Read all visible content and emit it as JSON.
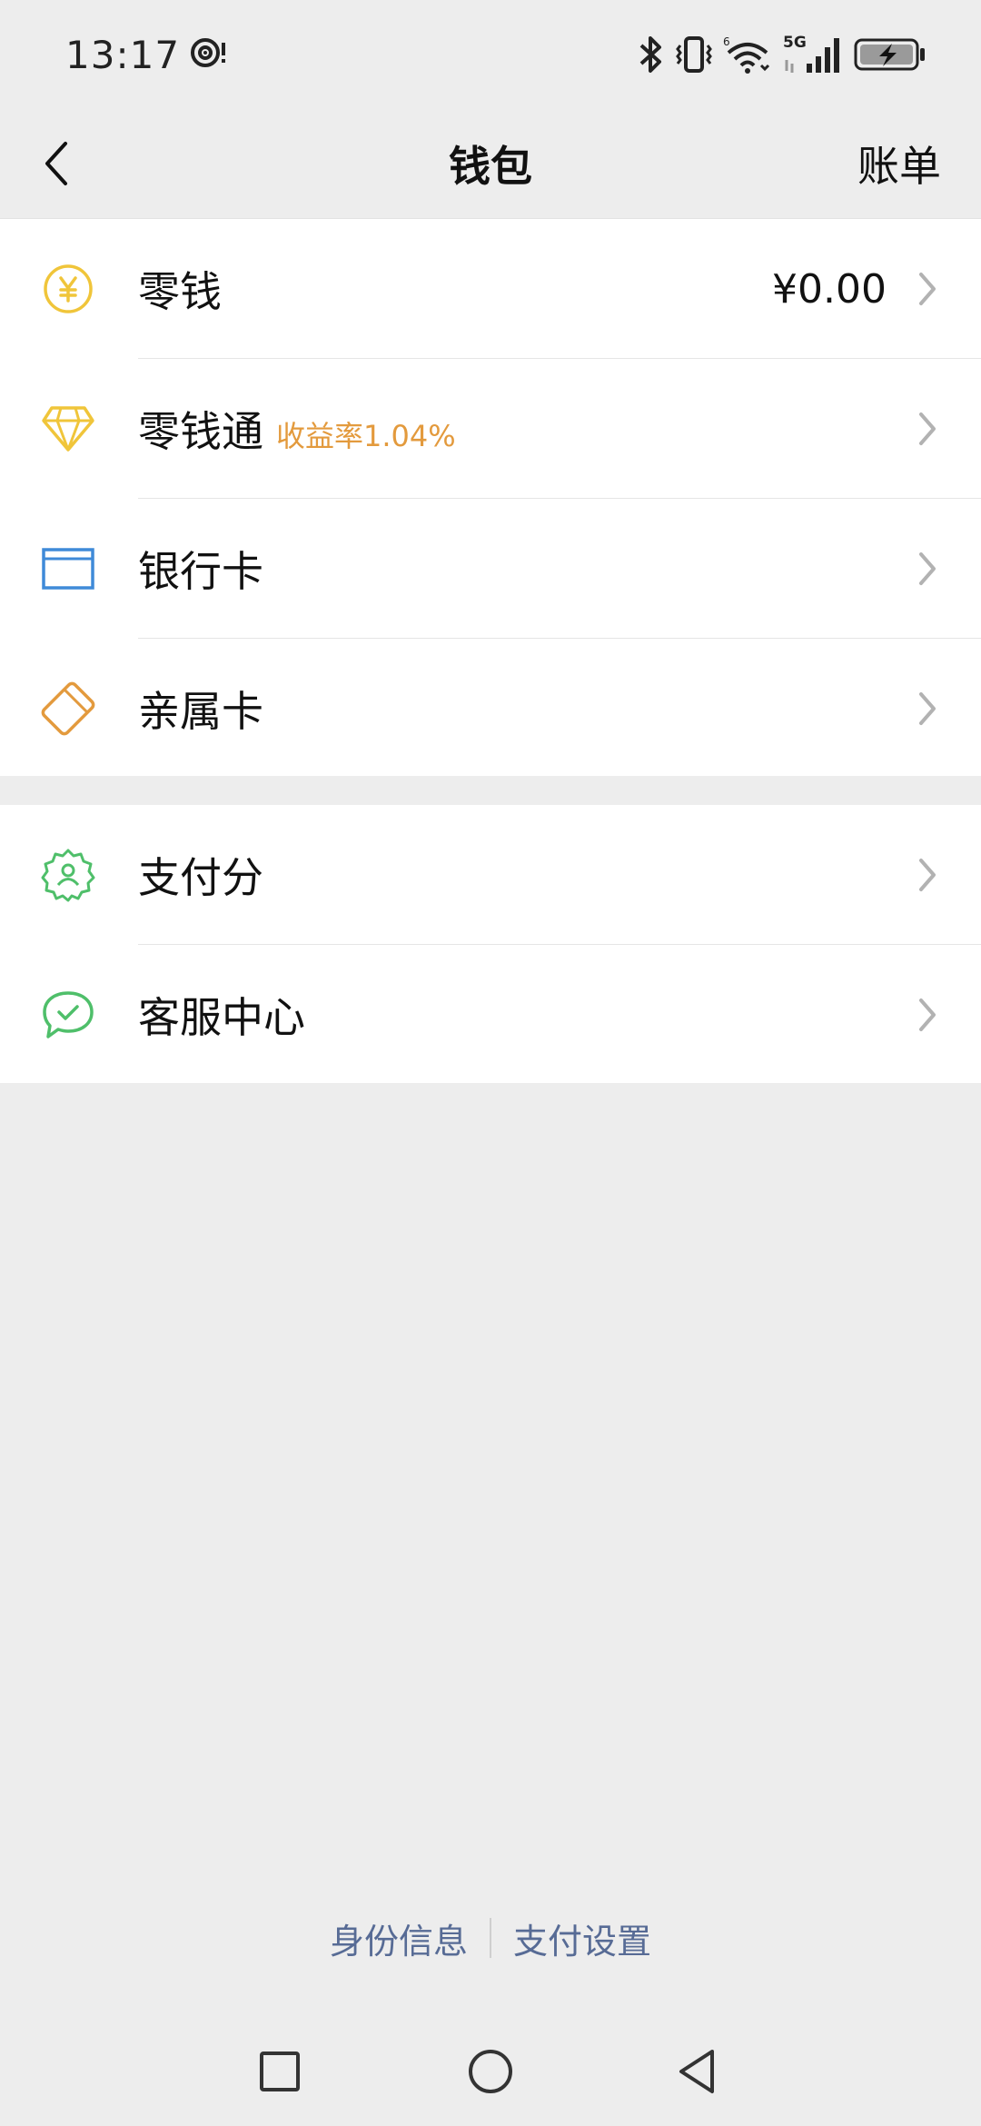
{
  "status_bar": {
    "time": "13:17",
    "icons": [
      "focus-mode-icon",
      "bluetooth-icon",
      "vibrate-icon",
      "wifi-icon",
      "5g-signal-icon",
      "battery-charging-icon"
    ],
    "network_label": "5G"
  },
  "nav": {
    "back_icon": "chevron-left-icon",
    "title": "钱包",
    "right_label": "账单"
  },
  "groups": [
    {
      "items": [
        {
          "icon": "yuan-coin-icon",
          "label": "零钱",
          "value": "¥0.00",
          "color": "#f0c53a"
        },
        {
          "icon": "diamond-icon",
          "label": "零钱通",
          "badge": "收益率1.04%",
          "color": "#f0c53a",
          "badge_color": "#e39a3d"
        },
        {
          "icon": "bank-card-icon",
          "label": "银行卡",
          "color": "#3f8ad8"
        },
        {
          "icon": "family-card-icon",
          "label": "亲属卡",
          "color": "#e39a3d"
        }
      ]
    },
    {
      "items": [
        {
          "icon": "payment-score-icon",
          "label": "支付分",
          "color": "#4fbf6a"
        },
        {
          "icon": "customer-service-icon",
          "label": "客服中心",
          "color": "#4fbf6a"
        }
      ]
    }
  ],
  "footer": {
    "identity_label": "身份信息",
    "settings_label": "支付设置",
    "link_color": "#576b95"
  },
  "system_nav": {
    "icons": [
      "recent-apps-icon",
      "home-icon",
      "back-icon"
    ]
  }
}
